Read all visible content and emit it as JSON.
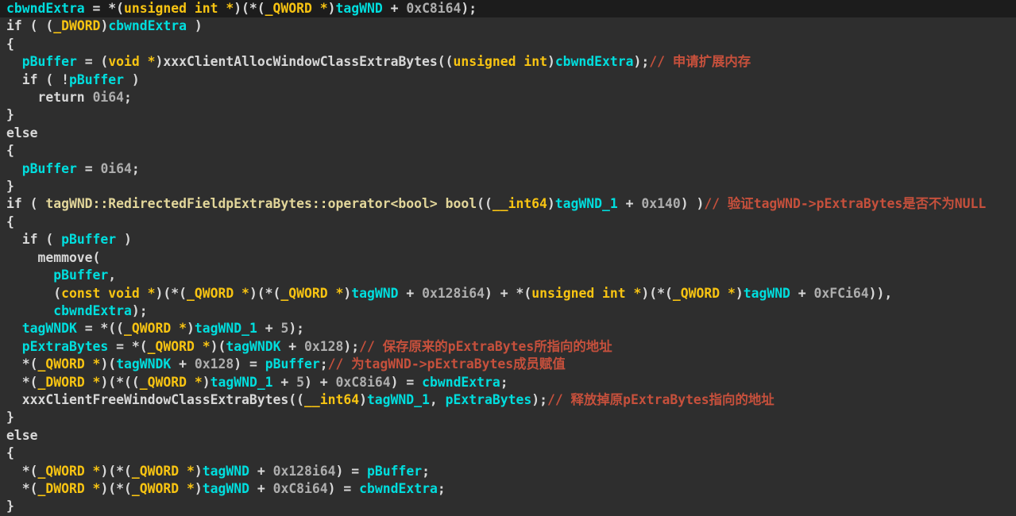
{
  "view": {
    "kind_label": "pseudocode-listing"
  },
  "colors": {
    "background": "#2e2e2e",
    "current_line_background": "#1c1c1c",
    "variable": "#00dede",
    "keyword": "#f8c412",
    "default_text": "#d8d8d8",
    "number": "#aeaeae",
    "demangled_name": "#e2d69a",
    "comment": "#c6503c"
  },
  "code": {
    "lines": [
      {
        "highlight": true,
        "tokens": [
          {
            "c": "var",
            "t": "cbwndExtra"
          },
          {
            "c": "txt",
            "t": " = *("
          },
          {
            "c": "kw",
            "t": "unsigned int *"
          },
          {
            "c": "txt",
            "t": ")(*("
          },
          {
            "c": "kw",
            "t": "_QWORD *"
          },
          {
            "c": "txt",
            "t": ")"
          },
          {
            "c": "var",
            "t": "tagWND"
          },
          {
            "c": "txt",
            "t": " + "
          },
          {
            "c": "num",
            "t": "0xC8i64"
          },
          {
            "c": "txt",
            "t": ");"
          }
        ]
      },
      {
        "highlight": false,
        "tokens": [
          {
            "c": "txt",
            "t": "if ( ("
          },
          {
            "c": "kw",
            "t": "_DWORD"
          },
          {
            "c": "txt",
            "t": ")"
          },
          {
            "c": "var",
            "t": "cbwndExtra"
          },
          {
            "c": "txt",
            "t": " )"
          }
        ]
      },
      {
        "highlight": false,
        "tokens": [
          {
            "c": "txt",
            "t": "{"
          }
        ]
      },
      {
        "highlight": false,
        "tokens": [
          {
            "c": "txt",
            "t": "  "
          },
          {
            "c": "var",
            "t": "pBuffer"
          },
          {
            "c": "txt",
            "t": " = ("
          },
          {
            "c": "kw",
            "t": "void *"
          },
          {
            "c": "txt",
            "t": ")xxxClientAllocWindowClassExtraBytes(("
          },
          {
            "c": "kw",
            "t": "unsigned int"
          },
          {
            "c": "txt",
            "t": ")"
          },
          {
            "c": "var",
            "t": "cbwndExtra"
          },
          {
            "c": "txt",
            "t": ");"
          },
          {
            "c": "com",
            "t": "// 申请扩展内存"
          }
        ]
      },
      {
        "highlight": false,
        "tokens": [
          {
            "c": "txt",
            "t": "  if ( !"
          },
          {
            "c": "var",
            "t": "pBuffer"
          },
          {
            "c": "txt",
            "t": " )"
          }
        ]
      },
      {
        "highlight": false,
        "tokens": [
          {
            "c": "txt",
            "t": "    return "
          },
          {
            "c": "num",
            "t": "0i64"
          },
          {
            "c": "txt",
            "t": ";"
          }
        ]
      },
      {
        "highlight": false,
        "tokens": [
          {
            "c": "txt",
            "t": "}"
          }
        ]
      },
      {
        "highlight": false,
        "tokens": [
          {
            "c": "txt",
            "t": "else"
          }
        ]
      },
      {
        "highlight": false,
        "tokens": [
          {
            "c": "txt",
            "t": "{"
          }
        ]
      },
      {
        "highlight": false,
        "tokens": [
          {
            "c": "txt",
            "t": "  "
          },
          {
            "c": "var",
            "t": "pBuffer"
          },
          {
            "c": "txt",
            "t": " = "
          },
          {
            "c": "num",
            "t": "0i64"
          },
          {
            "c": "txt",
            "t": ";"
          }
        ]
      },
      {
        "highlight": false,
        "tokens": [
          {
            "c": "txt",
            "t": "}"
          }
        ]
      },
      {
        "highlight": false,
        "tokens": [
          {
            "c": "txt",
            "t": "if ( "
          },
          {
            "c": "name",
            "t": "tagWND::RedirectedFieldpExtraBytes::operator<bool> bool"
          },
          {
            "c": "txt",
            "t": "(("
          },
          {
            "c": "kw",
            "t": "__int64"
          },
          {
            "c": "txt",
            "t": ")"
          },
          {
            "c": "var",
            "t": "tagWND_1"
          },
          {
            "c": "txt",
            "t": " + "
          },
          {
            "c": "num",
            "t": "0x140"
          },
          {
            "c": "txt",
            "t": ") )"
          },
          {
            "c": "com",
            "t": "// 验证tagWND->pExtraBytes是否不为NULL"
          }
        ]
      },
      {
        "highlight": false,
        "tokens": [
          {
            "c": "txt",
            "t": "{"
          }
        ]
      },
      {
        "highlight": false,
        "tokens": [
          {
            "c": "txt",
            "t": "  if ( "
          },
          {
            "c": "var",
            "t": "pBuffer"
          },
          {
            "c": "txt",
            "t": " )"
          }
        ]
      },
      {
        "highlight": false,
        "tokens": [
          {
            "c": "txt",
            "t": "    memmove("
          }
        ]
      },
      {
        "highlight": false,
        "tokens": [
          {
            "c": "txt",
            "t": "      "
          },
          {
            "c": "var",
            "t": "pBuffer"
          },
          {
            "c": "txt",
            "t": ","
          }
        ]
      },
      {
        "highlight": false,
        "tokens": [
          {
            "c": "txt",
            "t": "      ("
          },
          {
            "c": "kw",
            "t": "const void *"
          },
          {
            "c": "txt",
            "t": ")(*("
          },
          {
            "c": "kw",
            "t": "_QWORD *"
          },
          {
            "c": "txt",
            "t": ")(*("
          },
          {
            "c": "kw",
            "t": "_QWORD *"
          },
          {
            "c": "txt",
            "t": ")"
          },
          {
            "c": "var",
            "t": "tagWND"
          },
          {
            "c": "txt",
            "t": " + "
          },
          {
            "c": "num",
            "t": "0x128i64"
          },
          {
            "c": "txt",
            "t": ") + *("
          },
          {
            "c": "kw",
            "t": "unsigned int *"
          },
          {
            "c": "txt",
            "t": ")(*("
          },
          {
            "c": "kw",
            "t": "_QWORD *"
          },
          {
            "c": "txt",
            "t": ")"
          },
          {
            "c": "var",
            "t": "tagWND"
          },
          {
            "c": "txt",
            "t": " + "
          },
          {
            "c": "num",
            "t": "0xFCi64"
          },
          {
            "c": "txt",
            "t": ")),"
          }
        ]
      },
      {
        "highlight": false,
        "tokens": [
          {
            "c": "txt",
            "t": "      "
          },
          {
            "c": "var",
            "t": "cbwndExtra"
          },
          {
            "c": "txt",
            "t": ");"
          }
        ]
      },
      {
        "highlight": false,
        "tokens": [
          {
            "c": "txt",
            "t": "  "
          },
          {
            "c": "var",
            "t": "tagWNDK"
          },
          {
            "c": "txt",
            "t": " = *(("
          },
          {
            "c": "kw",
            "t": "_QWORD *"
          },
          {
            "c": "txt",
            "t": ")"
          },
          {
            "c": "var",
            "t": "tagWND_1"
          },
          {
            "c": "txt",
            "t": " + "
          },
          {
            "c": "num",
            "t": "5"
          },
          {
            "c": "txt",
            "t": ");"
          }
        ]
      },
      {
        "highlight": false,
        "tokens": [
          {
            "c": "txt",
            "t": "  "
          },
          {
            "c": "var",
            "t": "pExtraBytes"
          },
          {
            "c": "txt",
            "t": " = *("
          },
          {
            "c": "kw",
            "t": "_QWORD *"
          },
          {
            "c": "txt",
            "t": ")("
          },
          {
            "c": "var",
            "t": "tagWNDK"
          },
          {
            "c": "txt",
            "t": " + "
          },
          {
            "c": "num",
            "t": "0x128"
          },
          {
            "c": "txt",
            "t": ");"
          },
          {
            "c": "com",
            "t": "// 保存原来的pExtraBytes所指向的地址"
          }
        ]
      },
      {
        "highlight": false,
        "tokens": [
          {
            "c": "txt",
            "t": "  *("
          },
          {
            "c": "kw",
            "t": "_QWORD *"
          },
          {
            "c": "txt",
            "t": ")("
          },
          {
            "c": "var",
            "t": "tagWNDK"
          },
          {
            "c": "txt",
            "t": " + "
          },
          {
            "c": "num",
            "t": "0x128"
          },
          {
            "c": "txt",
            "t": ") = "
          },
          {
            "c": "var",
            "t": "pBuffer"
          },
          {
            "c": "txt",
            "t": ";"
          },
          {
            "c": "com",
            "t": "// 为tagWND->pExtraBytes成员赋值"
          }
        ]
      },
      {
        "highlight": false,
        "tokens": [
          {
            "c": "txt",
            "t": "  *("
          },
          {
            "c": "kw",
            "t": "_DWORD *"
          },
          {
            "c": "txt",
            "t": ")(*(("
          },
          {
            "c": "kw",
            "t": "_QWORD *"
          },
          {
            "c": "txt",
            "t": ")"
          },
          {
            "c": "var",
            "t": "tagWND_1"
          },
          {
            "c": "txt",
            "t": " + "
          },
          {
            "c": "num",
            "t": "5"
          },
          {
            "c": "txt",
            "t": ") + "
          },
          {
            "c": "num",
            "t": "0xC8i64"
          },
          {
            "c": "txt",
            "t": ") = "
          },
          {
            "c": "var",
            "t": "cbwndExtra"
          },
          {
            "c": "txt",
            "t": ";"
          }
        ]
      },
      {
        "highlight": false,
        "tokens": [
          {
            "c": "txt",
            "t": "  xxxClientFreeWindowClassExtraBytes(("
          },
          {
            "c": "kw",
            "t": "__int64"
          },
          {
            "c": "txt",
            "t": ")"
          },
          {
            "c": "var",
            "t": "tagWND_1"
          },
          {
            "c": "txt",
            "t": ", "
          },
          {
            "c": "var",
            "t": "pExtraBytes"
          },
          {
            "c": "txt",
            "t": ");"
          },
          {
            "c": "com",
            "t": "// 释放掉原pExtraBytes指向的地址"
          }
        ]
      },
      {
        "highlight": false,
        "tokens": [
          {
            "c": "txt",
            "t": "}"
          }
        ]
      },
      {
        "highlight": false,
        "tokens": [
          {
            "c": "txt",
            "t": "else"
          }
        ]
      },
      {
        "highlight": false,
        "tokens": [
          {
            "c": "txt",
            "t": "{"
          }
        ]
      },
      {
        "highlight": false,
        "tokens": [
          {
            "c": "txt",
            "t": "  *("
          },
          {
            "c": "kw",
            "t": "_QWORD *"
          },
          {
            "c": "txt",
            "t": ")(*("
          },
          {
            "c": "kw",
            "t": "_QWORD *"
          },
          {
            "c": "txt",
            "t": ")"
          },
          {
            "c": "var",
            "t": "tagWND"
          },
          {
            "c": "txt",
            "t": " + "
          },
          {
            "c": "num",
            "t": "0x128i64"
          },
          {
            "c": "txt",
            "t": ") = "
          },
          {
            "c": "var",
            "t": "pBuffer"
          },
          {
            "c": "txt",
            "t": ";"
          }
        ]
      },
      {
        "highlight": false,
        "tokens": [
          {
            "c": "txt",
            "t": "  *("
          },
          {
            "c": "kw",
            "t": "_DWORD *"
          },
          {
            "c": "txt",
            "t": ")(*("
          },
          {
            "c": "kw",
            "t": "_QWORD *"
          },
          {
            "c": "txt",
            "t": ")"
          },
          {
            "c": "var",
            "t": "tagWND"
          },
          {
            "c": "txt",
            "t": " + "
          },
          {
            "c": "num",
            "t": "0xC8i64"
          },
          {
            "c": "txt",
            "t": ") = "
          },
          {
            "c": "var",
            "t": "cbwndExtra"
          },
          {
            "c": "txt",
            "t": ";"
          }
        ]
      },
      {
        "highlight": false,
        "tokens": [
          {
            "c": "txt",
            "t": "}"
          }
        ]
      }
    ]
  }
}
